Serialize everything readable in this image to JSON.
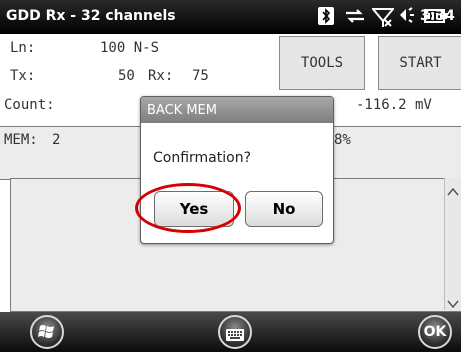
{
  "status_bar": {
    "app_title": "GDD Rx - 32 channels",
    "clock": "3:34",
    "icons": [
      "bluetooth-icon",
      "data-sync-icon",
      "signal-icon",
      "volume-icon",
      "battery-icon"
    ]
  },
  "readouts": {
    "ln_label": "Ln:",
    "ln_value": "100 N-S",
    "tx_label": "Tx:",
    "tx_value": "50",
    "rx_label": "Rx:",
    "rx_value": "75",
    "count_label": "Count:",
    "count_value": "-116.2 mV",
    "mem_label": "MEM:",
    "mem_value": "2",
    "percent_partial": "8%"
  },
  "toolbar": {
    "tools_label": "TOOLS",
    "start_label": "START"
  },
  "dialog": {
    "title": "BACK MEM",
    "message": "Confirmation?",
    "yes_label": "Yes",
    "no_label": "No"
  },
  "bottom_bar": {
    "ok_label": "OK"
  },
  "colors": {
    "highlight_ring": "#d60000",
    "status_bar_bg": "#000000"
  }
}
